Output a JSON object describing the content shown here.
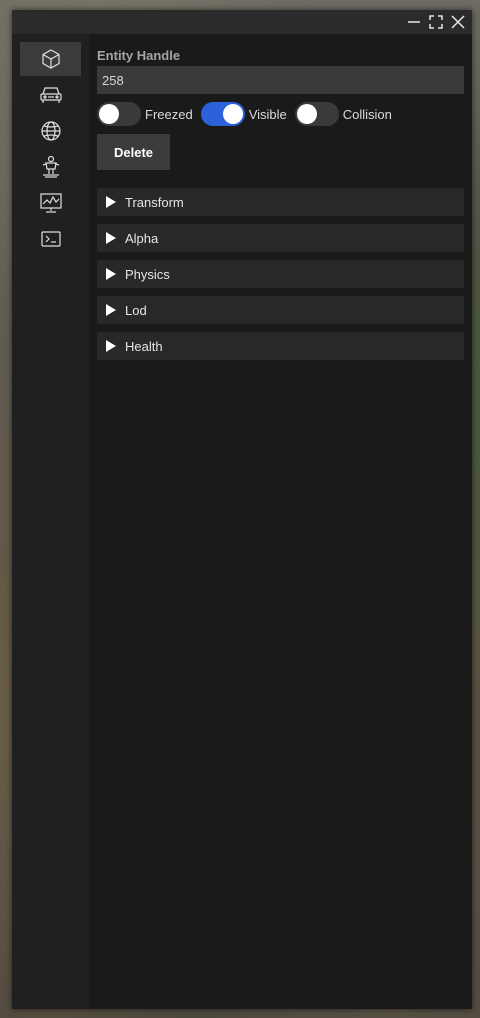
{
  "titlebar": {
    "icons": [
      "minimize-icon",
      "maximize-icon",
      "close-icon"
    ]
  },
  "sidebar": {
    "items": [
      {
        "icon": "cube-icon",
        "active": true
      },
      {
        "icon": "car-icon",
        "active": false
      },
      {
        "icon": "globe-icon",
        "active": false
      },
      {
        "icon": "ped-icon",
        "active": false
      },
      {
        "icon": "monitor-chart-icon",
        "active": false
      },
      {
        "icon": "terminal-icon",
        "active": false
      }
    ]
  },
  "entity": {
    "label": "Entity Handle",
    "value": "258"
  },
  "toggles": [
    {
      "label": "Freezed",
      "on": false
    },
    {
      "label": "Visible",
      "on": true
    },
    {
      "label": "Collision",
      "on": false
    }
  ],
  "delete_label": "Delete",
  "sections": [
    {
      "label": "Transform"
    },
    {
      "label": "Alpha"
    },
    {
      "label": "Physics"
    },
    {
      "label": "Lod"
    },
    {
      "label": "Health"
    }
  ],
  "colors": {
    "accent": "#2b62d9",
    "panel": "#1a1a1a",
    "sidebar": "#202020"
  }
}
